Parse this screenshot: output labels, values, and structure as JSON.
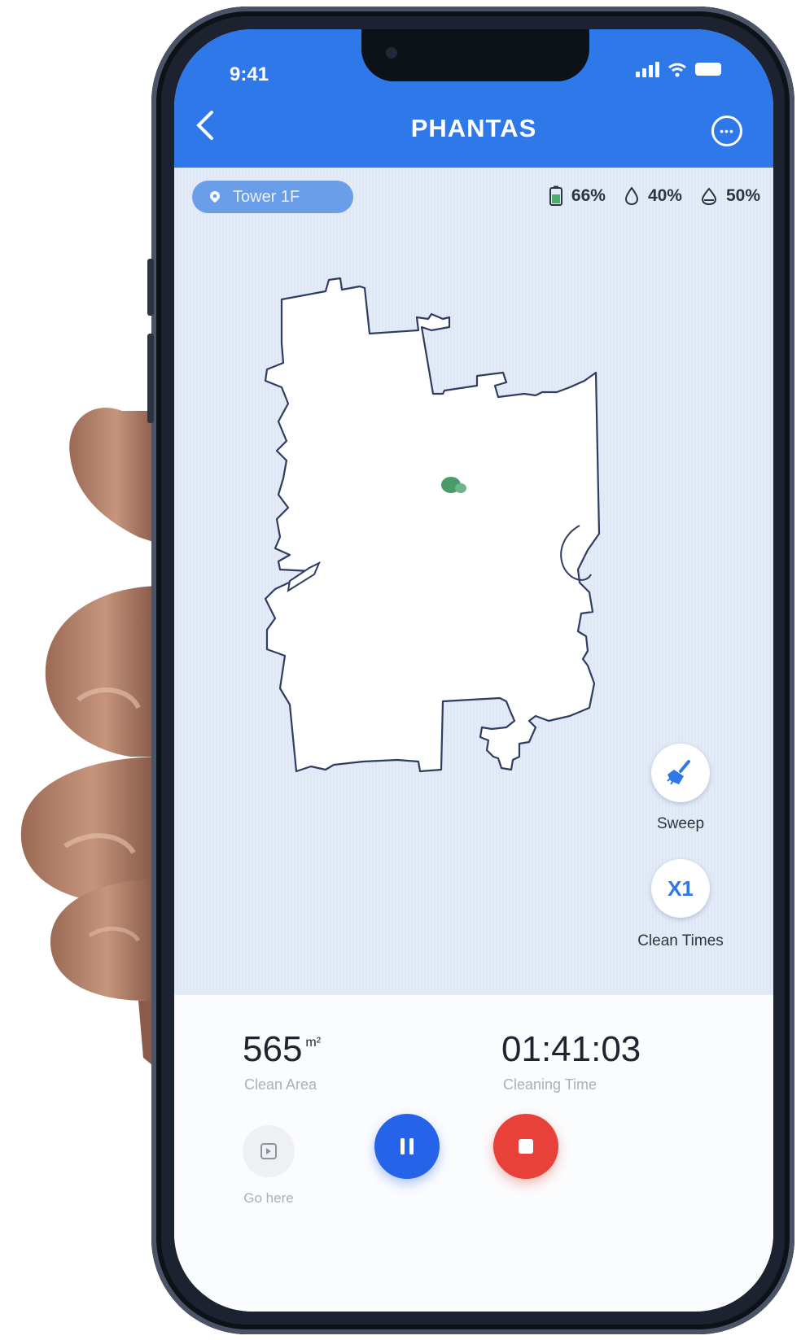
{
  "status_bar": {
    "time": "9:41"
  },
  "header": {
    "title": "PHANTAS"
  },
  "map": {
    "floor_label": "Tower 1F",
    "stats": {
      "battery": "66%",
      "water": "40%",
      "mop": "50%"
    },
    "actions": {
      "sweep_label": "Sweep",
      "clean_times_value": "X1",
      "clean_times_label": "Clean Times"
    }
  },
  "panel": {
    "clean_area_value": "565",
    "clean_area_unit": "m²",
    "clean_area_label": "Clean Area",
    "cleaning_time_value": "01:41:03",
    "cleaning_time_label": "Cleaning Time",
    "go_here_label": "Go here"
  },
  "colors": {
    "header_blue": "#2f78ea",
    "pause_blue": "#2563e8",
    "stop_red": "#e8413a",
    "robot_green": "#4c9a6a"
  }
}
